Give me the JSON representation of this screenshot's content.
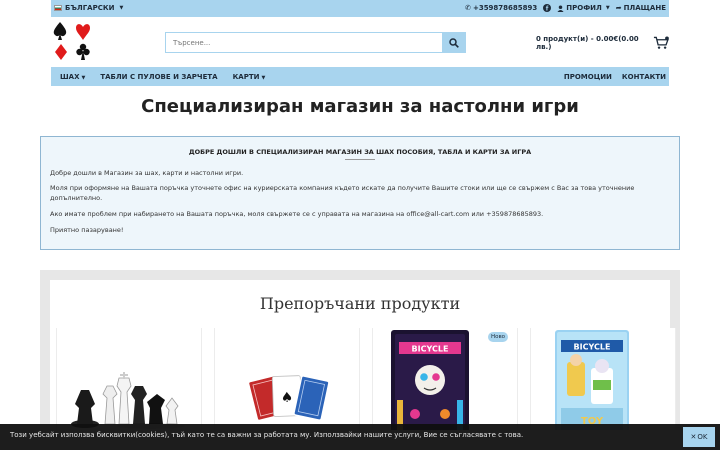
{
  "topbar": {
    "language": "БЪЛГАРСКИ",
    "phone": "+359878685893",
    "profile": "ПРОФИЛ",
    "checkout": "ПЛАЩАНЕ"
  },
  "search": {
    "placeholder": "Търсене..."
  },
  "cart": {
    "summary": "0 продукт(и) - 0.00€(0.00 лв.)"
  },
  "nav": {
    "left": [
      {
        "label": "ШАХ",
        "dropdown": true
      },
      {
        "label": "ТАБЛИ С ПУЛОВЕ И ЗАРЧЕТА",
        "dropdown": false
      },
      {
        "label": "КАРТИ",
        "dropdown": true
      }
    ],
    "right": [
      {
        "label": "ПРОМОЦИИ"
      },
      {
        "label": "КОНТАКТИ"
      }
    ]
  },
  "page_title": "Специализиран магазин за настолни игри",
  "welcome": {
    "title": "ДОБРЕ ДОШЛИ В СПЕЦИАЛИЗИРАН МАГАЗИН ЗА ШАХ ПОСОБИЯ, ТАБЛА И КАРТИ ЗА ИГРА",
    "p1": "Добре дошли в Магазин за шах, карти и настолни игри.",
    "p2": "Моля при оформяне на Вашата поръчка уточнете офис на куриерската компания където искате да получите Вашите стоки или ще се свържем с Вас за това уточнение допълнително.",
    "p3": "Ако имате проблем при набирането на Вашата поръчка, моля свържете се с управата на магазина на office@all-cart.com или +359878685893.",
    "p4": "Приятно пазаруване!"
  },
  "featured": {
    "title": "Препоръчани продукти",
    "badge": "Ново"
  },
  "cookie": {
    "text": "Този уебсайт използва бисквитки(cookies), тъй като те са важни за работата му. Използвайки нашите услуги, Вие се съгласявате с това.",
    "ok": "OK"
  },
  "colors": {
    "accent": "#a8d4ee",
    "dark": "#1d2b3a"
  }
}
